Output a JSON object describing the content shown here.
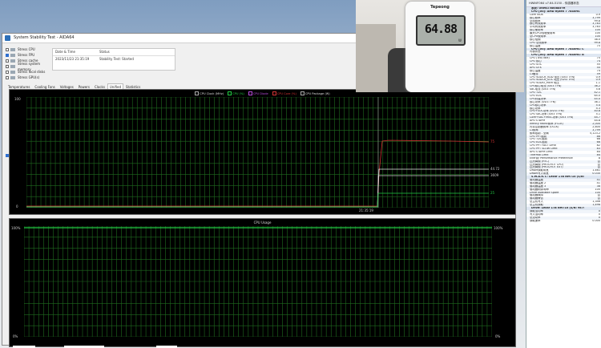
{
  "aida": {
    "window_title": "System Stability Test - AIDA64",
    "stress_options": [
      {
        "label": "Stress CPU",
        "checked": false
      },
      {
        "label": "Stress FPU",
        "checked": true
      },
      {
        "label": "Stress cache",
        "checked": false
      },
      {
        "label": "Stress system memory",
        "checked": false
      },
      {
        "label": "Stress local disks",
        "checked": false
      },
      {
        "label": "Stress GPU(s)",
        "checked": false
      }
    ],
    "status_table": {
      "header_date": "Date & Time",
      "header_status": "Status",
      "date_value": "2023/11/23 21:35:19",
      "status_value": "Stability Test: Started"
    },
    "tabs": [
      "Temperatures",
      "Cooling Fans",
      "Voltages",
      "Powers",
      "Clocks",
      "Unified",
      "Statistics"
    ],
    "active_tab": "Unified",
    "graph1": {
      "legend": [
        "CPU Clock (MHz)",
        "CPU (%)",
        "CPU Diode",
        "CPU Core (%)",
        "CPU Package (W)"
      ],
      "legend_colors": [
        "#e8e8e8",
        "#22cc44",
        "#b64bd8",
        "#d43333",
        "#e8e8e8"
      ],
      "y_top": "100",
      "y_bottom": "0",
      "time_label": "21:35:19",
      "right_labels": [
        "75",
        "44.72",
        "3609",
        "25"
      ],
      "right_label_colors": [
        "#d43333",
        "#e8e8e8",
        "#e8e8e8",
        "#22cc44"
      ]
    },
    "graph2": {
      "title": "CPU Usage",
      "y_top_left": "100%",
      "y_bottom_left": "0%",
      "y_top_right": "100%",
      "y_bottom_right": "0%"
    }
  },
  "photo": {
    "brand": "Tepeong",
    "reading": "64.88",
    "unit": "W"
  },
  "hwinfo": {
    "title": "HWiNFO64 v7.64-5150 - 传感器状态",
    "rows": [
      {
        "type": "sec",
        "name": "系统: ORMSI NovBox-M",
        "value": ""
      },
      {
        "type": "sec",
        "name": "CPU [#0]: AMD Ryzen 7 7840HS",
        "value": ""
      },
      {
        "type": "row",
        "name": "Core VIDs",
        "value": "0.9"
      },
      {
        "type": "row",
        "name": "核心频率",
        "value": "3,799"
      },
      {
        "type": "row",
        "name": "总线频率",
        "value": "99.8"
      },
      {
        "type": "row",
        "name": "核心有效频率",
        "value": "3,783"
      },
      {
        "type": "row",
        "name": "平均有效频率",
        "value": "3,783"
      },
      {
        "type": "row",
        "name": "核心使用率",
        "value": "100"
      },
      {
        "type": "row",
        "name": "最大CPU/线程使用率",
        "value": "100"
      },
      {
        "type": "row",
        "name": "总CPU使用率",
        "value": "100"
      },
      {
        "type": "row",
        "name": "核心倍频",
        "value": "38.0"
      },
      {
        "type": "row",
        "name": "CPU 总线频率",
        "value": "99.8"
      },
      {
        "type": "row",
        "name": "核心温度",
        "value": "75"
      },
      {
        "type": "sec",
        "name": "CPU [#0]: AMD Ryzen 7 7840HS: C-State 状态",
        "value": ""
      },
      {
        "type": "row",
        "name": "内核状态",
        "value": ""
      },
      {
        "type": "sec",
        "name": "CPU [#0]: AMD Ryzen 7 7840HS: Enhanced",
        "value": ""
      },
      {
        "type": "row",
        "name": "CPU (Tctl/Tdie)",
        "value": "75"
      },
      {
        "type": "row",
        "name": "CPU 核心",
        "value": "74"
      },
      {
        "type": "row",
        "name": "CPU SOC",
        "value": "55"
      },
      {
        "type": "row",
        "name": "APU GFX",
        "value": "50"
      },
      {
        "type": "row",
        "name": "核心温度",
        "value": "74"
      },
      {
        "type": "row",
        "name": "L3缓存",
        "value": "59"
      },
      {
        "type": "row",
        "name": "CPU VDDCR_VDD 电压 (SVI3 TFN)",
        "value": "0.9"
      },
      {
        "type": "row",
        "name": "CPU VDDCR_SOC 电压 (SVI3 TFN)",
        "value": "0.9"
      },
      {
        "type": "row",
        "name": "CPU VDDIO_MEM 电压",
        "value": "1.1"
      },
      {
        "type": "row",
        "name": "CPU核心电流 (SVI3 TFN)",
        "value": "36.2"
      },
      {
        "type": "row",
        "name": "SoC电流 (SVI3 TFN)",
        "value": "5.6"
      },
      {
        "type": "row",
        "name": "CPU TDC",
        "value": "42.1"
      },
      {
        "type": "row",
        "name": "CPU EDC",
        "value": "65.0"
      },
      {
        "type": "row",
        "name": "CPU封装功率",
        "value": "45.0"
      },
      {
        "type": "row",
        "name": "核心功率 (SVI3 TFN)",
        "value": "36.1"
      },
      {
        "type": "row",
        "name": "CPU核心功率",
        "value": "5.4"
      },
      {
        "type": "row",
        "name": "核心功率",
        "value": "4.3"
      },
      {
        "type": "row",
        "name": "CPU+SOC功率 (SVI3 TFN)",
        "value": "40.8"
      },
      {
        "type": "row",
        "name": "CPU SoC功率 (SVI3 TFN)",
        "value": "5.1"
      },
      {
        "type": "row",
        "name": "Core+SoC+MISC功率 (SVI3 TFN)",
        "value": "44.7"
      },
      {
        "type": "row",
        "name": "APU STAPM",
        "value": "44.8"
      },
      {
        "type": "row",
        "name": "Infinity Fabric频率 (FCLK)",
        "value": "2,000"
      },
      {
        "type": "row",
        "name": "内存控制器频率 (UCLK)",
        "value": "2,800"
      },
      {
        "type": "row",
        "name": "L3频率",
        "value": "3,799"
      },
      {
        "type": "row",
        "name": "频率限制 - 全局",
        "value": "5,123.2"
      },
      {
        "type": "row",
        "name": "CPU PPT限制",
        "value": "86"
      },
      {
        "type": "row",
        "name": "CPU TDC限制",
        "value": "66"
      },
      {
        "type": "row",
        "name": "CPU EDC限制",
        "value": "66"
      },
      {
        "type": "row",
        "name": "CPU PPT FAST Limit",
        "value": "82"
      },
      {
        "type": "row",
        "name": "CPU PPT SLOW Limit",
        "value": "83"
      },
      {
        "type": "row",
        "name": "APU STAPM Limit",
        "value": "84"
      },
      {
        "type": "row",
        "name": "Thermal Limit",
        "value": "84"
      },
      {
        "type": "row",
        "name": "Energy Performance Preference",
        "value": "8"
      },
      {
        "type": "row",
        "name": "过热降频 (HTC)",
        "value": "否"
      },
      {
        "type": "row",
        "name": "过热降频 (PROCHOT CPU)",
        "value": "否"
      },
      {
        "type": "row",
        "name": "过热降频 (PROCHOT EXT)",
        "value": "否"
      },
      {
        "type": "row",
        "name": "DRAM读取带宽",
        "value": "1.461"
      },
      {
        "type": "row",
        "name": "DRAM写入带宽",
        "value": "0.030"
      },
      {
        "type": "sec",
        "name": "S.M.A.R.T.: Lexar 1TB NM710 (S/N: 9E7428A8)",
        "value": ""
      },
      {
        "type": "row",
        "name": "驱动器温度",
        "value": "41"
      },
      {
        "type": "row",
        "name": "驱动器温度 2",
        "value": "41"
      },
      {
        "type": "row",
        "name": "驱动器温度 3",
        "value": "38"
      },
      {
        "type": "row",
        "name": "驱动器剩余寿命",
        "value": "100"
      },
      {
        "type": "row",
        "name": "Drive Available Spare",
        "value": "100"
      },
      {
        "type": "row",
        "name": "驱动器故障",
        "value": "否"
      },
      {
        "type": "row",
        "name": "驱动器警告",
        "value": "否"
      },
      {
        "type": "row",
        "name": "总主机写入",
        "value": "1,346"
      },
      {
        "type": "row",
        "name": "总主机读取",
        "value": "1,498"
      },
      {
        "type": "sec",
        "name": "Drive: Lexar 1TB NM710 (S/N: 9E7428A8)",
        "value": ""
      },
      {
        "type": "row",
        "name": "读取活动率",
        "value": "0"
      },
      {
        "type": "row",
        "name": "写入活动率",
        "value": "0"
      },
      {
        "type": "row",
        "name": "总活动率",
        "value": "0"
      },
      {
        "type": "row",
        "name": "读取速率",
        "value": "0.000"
      }
    ]
  }
}
